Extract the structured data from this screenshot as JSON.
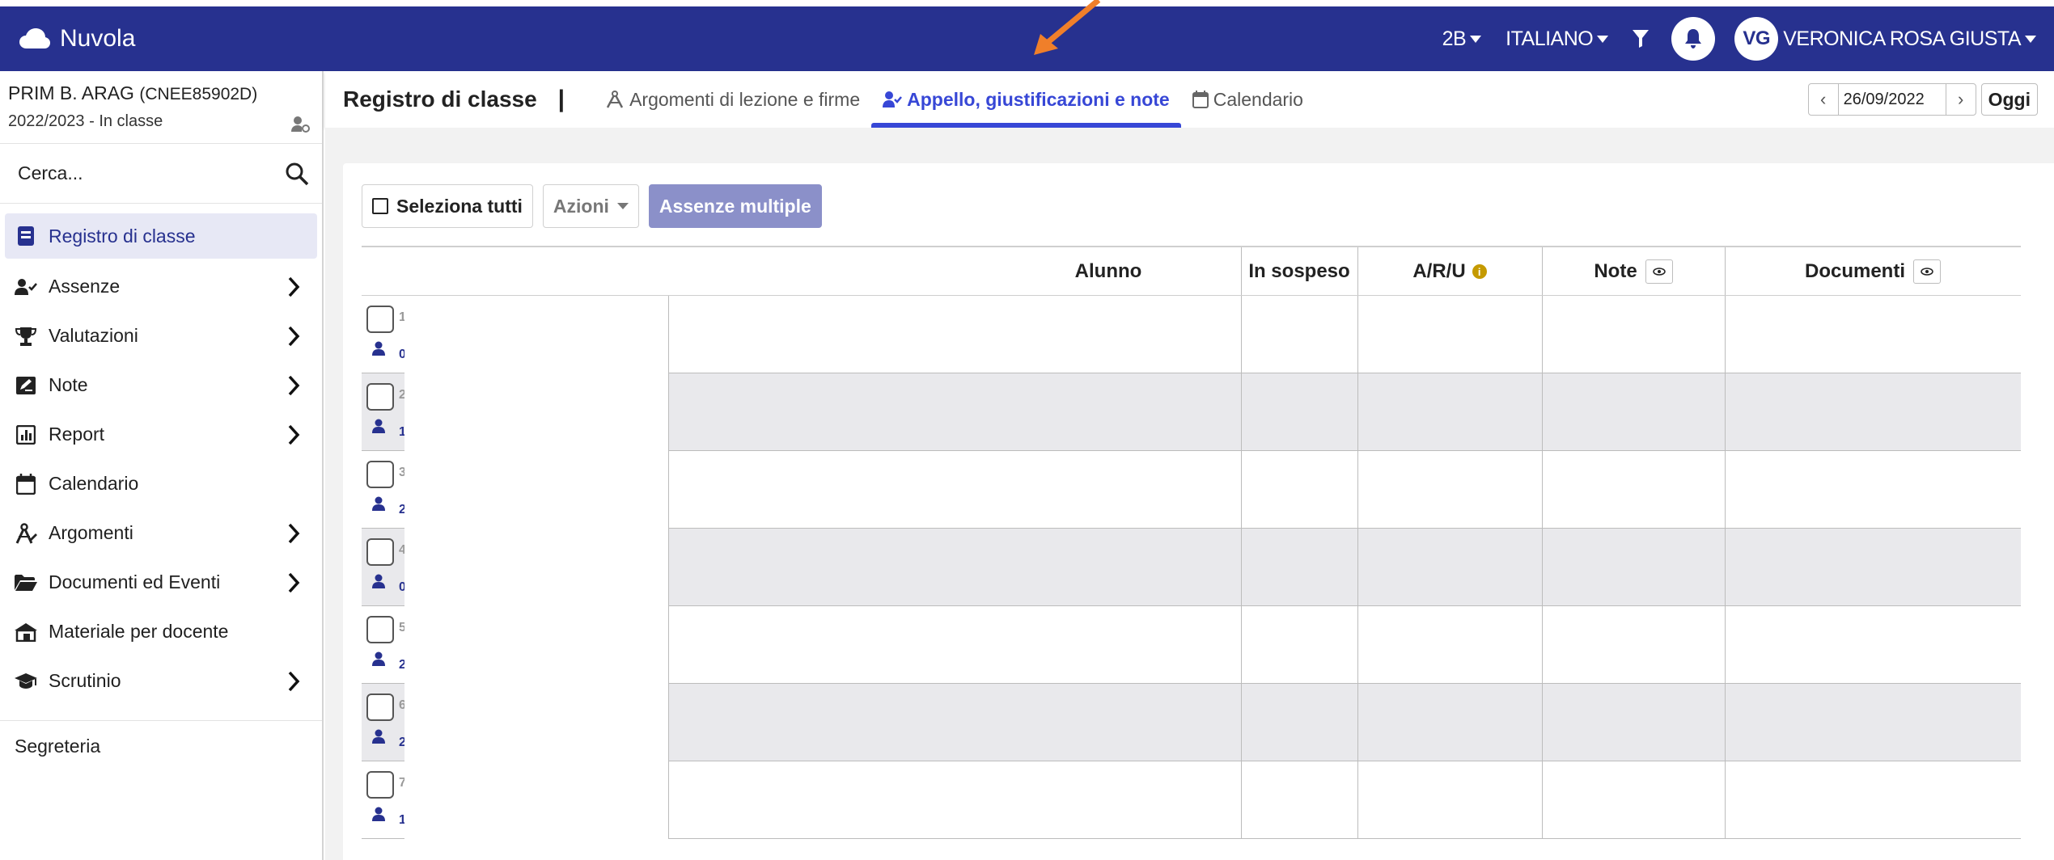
{
  "app": {
    "name": "Nuvola"
  },
  "topbar": {
    "class_label": "2B",
    "language_label": "ITALIANO",
    "avatar_initials": "VG",
    "user_name": "VERONICA ROSA GIUSTA"
  },
  "colors": {
    "brand": "#27318f",
    "active_tab": "#3747d6",
    "annotation_arrow": "#f07f2a"
  },
  "sidebar": {
    "school_name": "PRIM B. ARAG",
    "school_code": "(CNEE85902D)",
    "school_year": "2022/2023 - In classe",
    "search_placeholder": "Cerca...",
    "items": [
      {
        "label": "Registro di classe",
        "icon": "book-icon",
        "active": true,
        "has_submenu": false
      },
      {
        "label": "Assenze",
        "icon": "user-check-icon",
        "active": false,
        "has_submenu": true
      },
      {
        "label": "Valutazioni",
        "icon": "trophy-icon",
        "active": false,
        "has_submenu": true
      },
      {
        "label": "Note",
        "icon": "note-edit-icon",
        "active": false,
        "has_submenu": true
      },
      {
        "label": "Report",
        "icon": "chart-icon",
        "active": false,
        "has_submenu": true
      },
      {
        "label": "Calendario",
        "icon": "calendar-icon",
        "active": false,
        "has_submenu": false
      },
      {
        "label": "Argomenti",
        "icon": "compass-icon",
        "active": false,
        "has_submenu": true
      },
      {
        "label": "Documenti ed Eventi",
        "icon": "folder-open-icon",
        "active": false,
        "has_submenu": true
      },
      {
        "label": "Materiale per docente",
        "icon": "school-material-icon",
        "active": false,
        "has_submenu": false
      },
      {
        "label": "Scrutinio",
        "icon": "graduation-cap-icon",
        "active": false,
        "has_submenu": true
      }
    ],
    "footer_label": "Segreteria"
  },
  "header": {
    "title": "Registro di classe",
    "separator": "|",
    "tabs": [
      {
        "label": "Argomenti di lezione e firme",
        "icon": "compass-icon",
        "active": false
      },
      {
        "label": "Appello, giustificazioni e note",
        "icon": "user-check-icon",
        "active": true
      },
      {
        "label": "Calendario",
        "icon": "calendar-icon",
        "active": false
      }
    ],
    "date_value": "26/09/2022",
    "today_label": "Oggi"
  },
  "toolbar": {
    "select_all_label": "Seleziona tutti",
    "actions_label": "Azioni",
    "multiple_absences_label": "Assenze multiple"
  },
  "table": {
    "columns": [
      "Alunno",
      "In sospeso",
      "A/R/U",
      "Note",
      "Documenti"
    ],
    "aru_info_icon": "info-icon",
    "rows": [
      {
        "num_fragment": "1",
        "sub_fragment": "0"
      },
      {
        "num_fragment": "2",
        "sub_fragment": "1"
      },
      {
        "num_fragment": "3",
        "sub_fragment": "2"
      },
      {
        "num_fragment": "4",
        "sub_fragment": "0"
      },
      {
        "num_fragment": "5",
        "sub_fragment": "2"
      },
      {
        "num_fragment": "6",
        "sub_fragment": "2"
      },
      {
        "num_fragment": "7",
        "sub_fragment": "1"
      }
    ]
  }
}
